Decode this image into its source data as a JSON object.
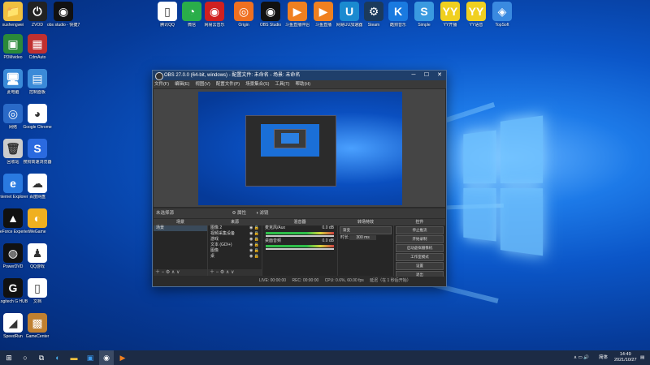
{
  "desktop_icons_left": [
    {
      "label": "xushengwei",
      "color": "#f0c040",
      "glyph": "📁"
    },
    {
      "label": "ZVOD",
      "color": "#222",
      "glyph": "⏻"
    },
    {
      "label": "obs studio - 快捷方式",
      "color": "#111",
      "glyph": "◉"
    },
    {
      "label": "PDMvideo",
      "color": "#2a8a3a",
      "glyph": "▣"
    },
    {
      "label": "CdmAuto",
      "color": "#c03030",
      "glyph": "▦"
    },
    {
      "label": "此电脑",
      "color": "#3a8ad8",
      "glyph": "🖥"
    },
    {
      "label": "控制面板",
      "color": "#3a8ad8",
      "glyph": "▤"
    },
    {
      "label": "网络",
      "color": "#2a6ac8",
      "glyph": "◎"
    },
    {
      "label": "Google Chrome",
      "color": "#fff",
      "glyph": "◕"
    },
    {
      "label": "回收站",
      "color": "#ccc",
      "glyph": "🗑"
    },
    {
      "label": "搜狗高速浏览器",
      "color": "#2a6ae0",
      "glyph": "S"
    },
    {
      "label": "Internet Explorer",
      "color": "#2a7ae0",
      "glyph": "e"
    },
    {
      "label": "百度网盘",
      "color": "#fff",
      "glyph": "☁"
    },
    {
      "label": "GeForce Experience",
      "color": "#111",
      "glyph": "▲"
    },
    {
      "label": "WeGame",
      "color": "#f0b020",
      "glyph": "◐"
    },
    {
      "label": "PowerDVD",
      "color": "#111",
      "glyph": "◍"
    },
    {
      "label": "QQ游戏",
      "color": "#fff",
      "glyph": "♟"
    },
    {
      "label": "Logitech G HUB",
      "color": "#111",
      "glyph": "G"
    },
    {
      "label": "文档",
      "color": "#fff",
      "glyph": "▯"
    },
    {
      "label": "SpeedRun",
      "color": "#fff",
      "glyph": "◢"
    },
    {
      "label": "GameCenter",
      "color": "#c08030",
      "glyph": "▩"
    }
  ],
  "desktop_icons_top": [
    {
      "label": "腾讯QQ",
      "color": "#fff",
      "glyph": "▯"
    },
    {
      "label": "微信",
      "color": "#2aae4a",
      "glyph": "◔"
    },
    {
      "label": "网易云音乐",
      "color": "#d02020",
      "glyph": "◉"
    },
    {
      "label": "Origin",
      "color": "#f07020",
      "glyph": "◎"
    },
    {
      "label": "OBS Studio",
      "color": "#111",
      "glyph": "◉"
    },
    {
      "label": "斗鱼直播伴侣",
      "color": "#f08020",
      "glyph": "▶"
    },
    {
      "label": "斗鱼直播",
      "color": "#f08020",
      "glyph": "▶"
    },
    {
      "label": "网易UU加速器",
      "color": "#1a8ad0",
      "glyph": "U"
    },
    {
      "label": "Steam",
      "color": "#1b3a5c",
      "glyph": "⚙"
    },
    {
      "label": "酷狗音乐",
      "color": "#1a7ae0",
      "glyph": "K"
    },
    {
      "label": "Simple",
      "color": "#3a9ae0",
      "glyph": "S"
    },
    {
      "label": "YY开播",
      "color": "#f0d020",
      "glyph": "YY"
    },
    {
      "label": "YY语音",
      "color": "#f0d020",
      "glyph": "YY"
    },
    {
      "label": "TopSoft",
      "color": "#3a8ae0",
      "glyph": "◈"
    }
  ],
  "obs": {
    "title": "OBS 27.0.0 (64-bit, windows) - 配置文件: 未命名 - 场景: 未命名",
    "menu": [
      "文件(F)",
      "编辑(E)",
      "视图(V)",
      "配置文件(P)",
      "场景集合(S)",
      "工具(T)",
      "帮助(H)"
    ],
    "source_strip": {
      "label": "未选择源",
      "props": "属性",
      "filters": "滤镜"
    },
    "scenes": {
      "header": "场景",
      "items": [
        "场景"
      ]
    },
    "sources": {
      "header": "来源",
      "items": [
        "图像 2",
        "视频采集设备",
        "游戏",
        "文本 (GDI+)",
        "图像",
        "桌"
      ]
    },
    "mixer": {
      "header": "混音器",
      "channels": [
        {
          "name": "麦克风/Aux",
          "db": "0.0 dB"
        },
        {
          "name": "桌面音频",
          "db": "0.0 dB"
        }
      ]
    },
    "transitions": {
      "header": "转场特效",
      "type": "渐变",
      "duration_label": "时长",
      "duration": "300 ms"
    },
    "controls": {
      "header": "控件",
      "buttons": [
        "停止推流",
        "开始录制",
        "启动虚拟摄像机",
        "工作室模式",
        "设置",
        "退出"
      ]
    },
    "status": {
      "live": "LIVE: 00:00:00",
      "rec": "REC: 00:00:00",
      "cpu": "CPU: 0.6%, 60.00 fps",
      "delay": "延迟（在 1 秒后开始）"
    }
  },
  "taskbar": {
    "lang": "简体",
    "time": "14:49",
    "date": "2021/10/27"
  }
}
